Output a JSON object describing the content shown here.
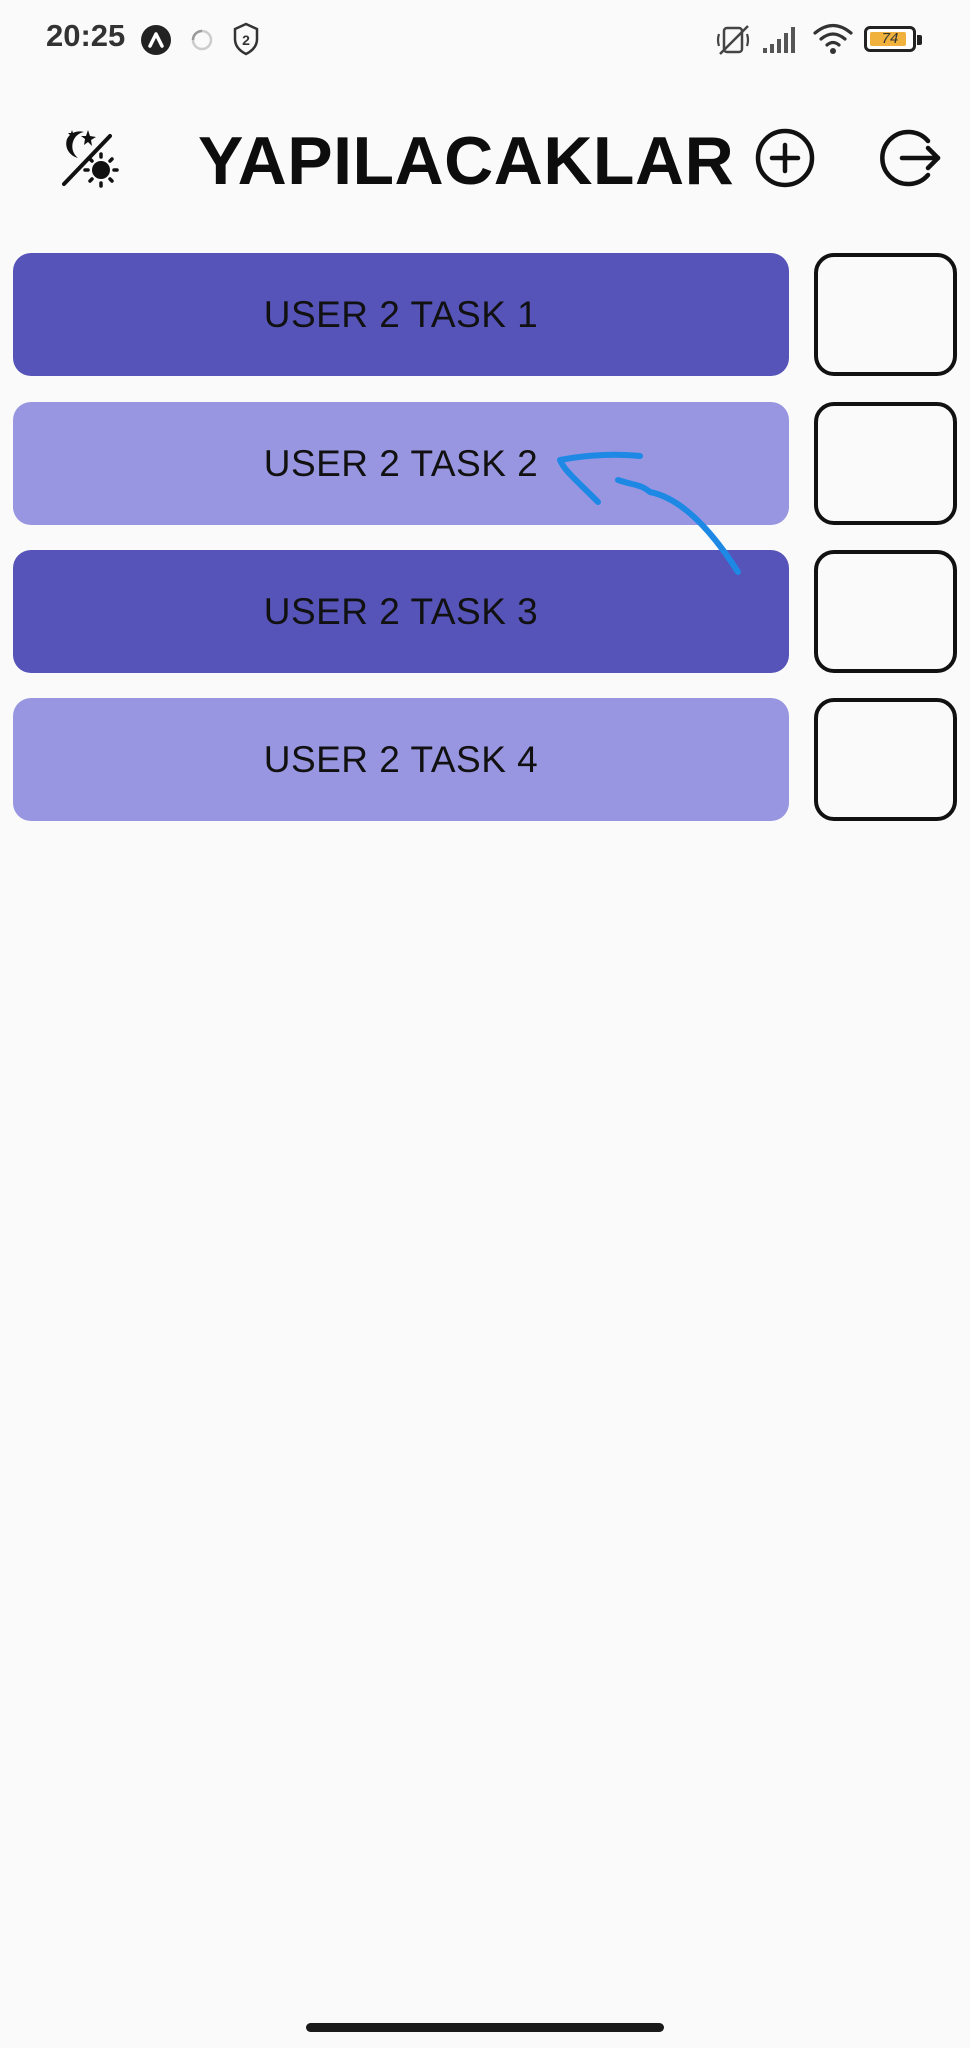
{
  "status_bar": {
    "time": "20:25",
    "battery_level": "74",
    "icons": [
      "app-notification-icon",
      "loading-circle-icon",
      "vpn-shield-icon",
      "mute-icon",
      "signal-icon",
      "wifi-icon",
      "battery-icon"
    ]
  },
  "header": {
    "title": "YAPILACAKLAR",
    "icons": [
      "theme-toggle-icon",
      "add-circle-icon",
      "logout-icon"
    ]
  },
  "tasks": [
    {
      "label": "USER 2 TASK 1",
      "checked": false,
      "color": "#5654b9"
    },
    {
      "label": "USER 2 TASK 2",
      "checked": false,
      "color": "#9896e1"
    },
    {
      "label": "USER 2 TASK 3",
      "checked": false,
      "color": "#5654b9"
    },
    {
      "label": "USER 2 TASK 4",
      "checked": false,
      "color": "#9896e1"
    }
  ],
  "colors": {
    "background": "#fafafa",
    "task_dark": "#5654b9",
    "task_light": "#9896e1",
    "annotation_stroke": "#1e88e5",
    "battery_fill": "#f0b23c"
  }
}
